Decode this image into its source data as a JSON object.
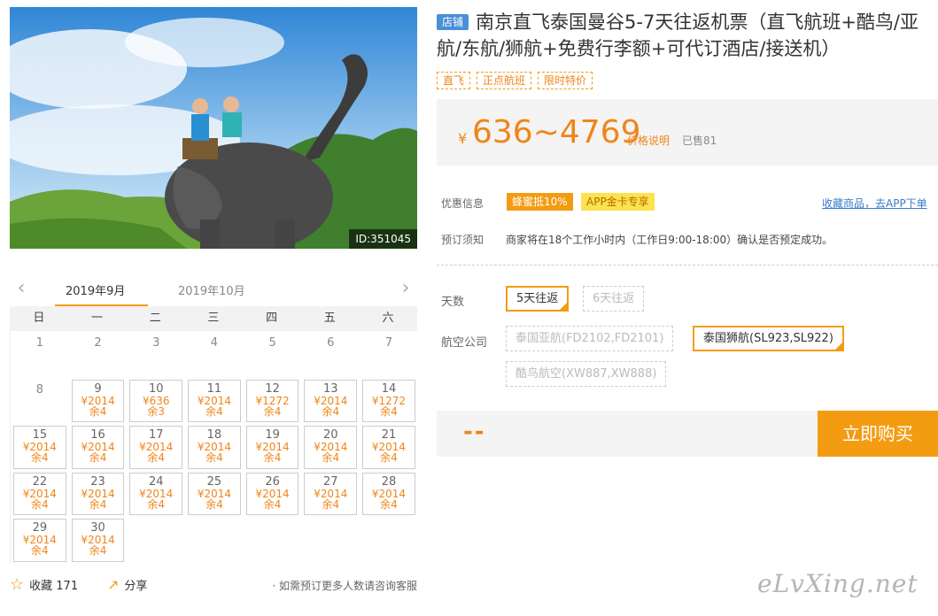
{
  "photo": {
    "id_label": "ID:351045"
  },
  "calendar": {
    "active_month": "2019年9月",
    "next_month": "2019年10月",
    "prev_arrow": "‹",
    "next_arrow": "›",
    "weekdays": [
      "日",
      "一",
      "二",
      "三",
      "四",
      "五",
      "六"
    ],
    "days": [
      {
        "d": "1"
      },
      {
        "d": "2"
      },
      {
        "d": "3"
      },
      {
        "d": "4"
      },
      {
        "d": "5"
      },
      {
        "d": "6"
      },
      {
        "d": "7"
      },
      {
        "d": "8"
      },
      {
        "d": "9",
        "price": "¥2014",
        "left": "余4"
      },
      {
        "d": "10",
        "price": "¥636",
        "left": "余3"
      },
      {
        "d": "11",
        "price": "¥2014",
        "left": "余4"
      },
      {
        "d": "12",
        "price": "¥1272",
        "left": "余4"
      },
      {
        "d": "13",
        "price": "¥2014",
        "left": "余4"
      },
      {
        "d": "14",
        "price": "¥1272",
        "left": "余4"
      },
      {
        "d": "15",
        "price": "¥2014",
        "left": "余4"
      },
      {
        "d": "16",
        "price": "¥2014",
        "left": "余4"
      },
      {
        "d": "17",
        "price": "¥2014",
        "left": "余4"
      },
      {
        "d": "18",
        "price": "¥2014",
        "left": "余4"
      },
      {
        "d": "19",
        "price": "¥2014",
        "left": "余4"
      },
      {
        "d": "20",
        "price": "¥2014",
        "left": "余4"
      },
      {
        "d": "21",
        "price": "¥2014",
        "left": "余4"
      },
      {
        "d": "22",
        "price": "¥2014",
        "left": "余4"
      },
      {
        "d": "23",
        "price": "¥2014",
        "left": "余4"
      },
      {
        "d": "24",
        "price": "¥2014",
        "left": "余4"
      },
      {
        "d": "25",
        "price": "¥2014",
        "left": "余4"
      },
      {
        "d": "26",
        "price": "¥2014",
        "left": "余4"
      },
      {
        "d": "27",
        "price": "¥2014",
        "left": "余4"
      },
      {
        "d": "28",
        "price": "¥2014",
        "left": "余4"
      },
      {
        "d": "29",
        "price": "¥2014",
        "left": "余4"
      },
      {
        "d": "30",
        "price": "¥2014",
        "left": "余4"
      }
    ]
  },
  "footer": {
    "fav_label": "收藏 171",
    "share_label": "分享",
    "consult_note": "· 如需预订更多人数请咨询客服"
  },
  "product": {
    "shop_badge": "店铺",
    "title": "南京直飞泰国曼谷5-7天往返机票（直飞航班+酷鸟/亚航/东航/狮航+免费行李额+可代订酒店/接送机）",
    "tags": [
      "直飞",
      "正点航班",
      "限时特价"
    ],
    "price_symbol": "¥",
    "price_range": "636~4769",
    "price_note": "价格说明",
    "sold": "已售81",
    "promo_label": "优惠信息",
    "promo_discount": "蜂蜜抵10%",
    "promo_app": "APP金卡专享",
    "app_link": "收藏商品，去APP下单",
    "notice_label": "预订须知",
    "notice_text": "商家将在18个工作小时内（工作日9:00-18:00）确认是否预定成功。",
    "days_label": "天数",
    "days_options": [
      "5天往返",
      "6天往返"
    ],
    "airline_label": "航空公司",
    "airline_options": [
      "泰国亚航(FD2102,FD2101)",
      "泰国狮航(SL923,SL922)",
      "酷鸟航空(XW887,XW888)"
    ],
    "total": "--",
    "buy_label": "立即购买"
  },
  "watermark": "eLvXing.net"
}
